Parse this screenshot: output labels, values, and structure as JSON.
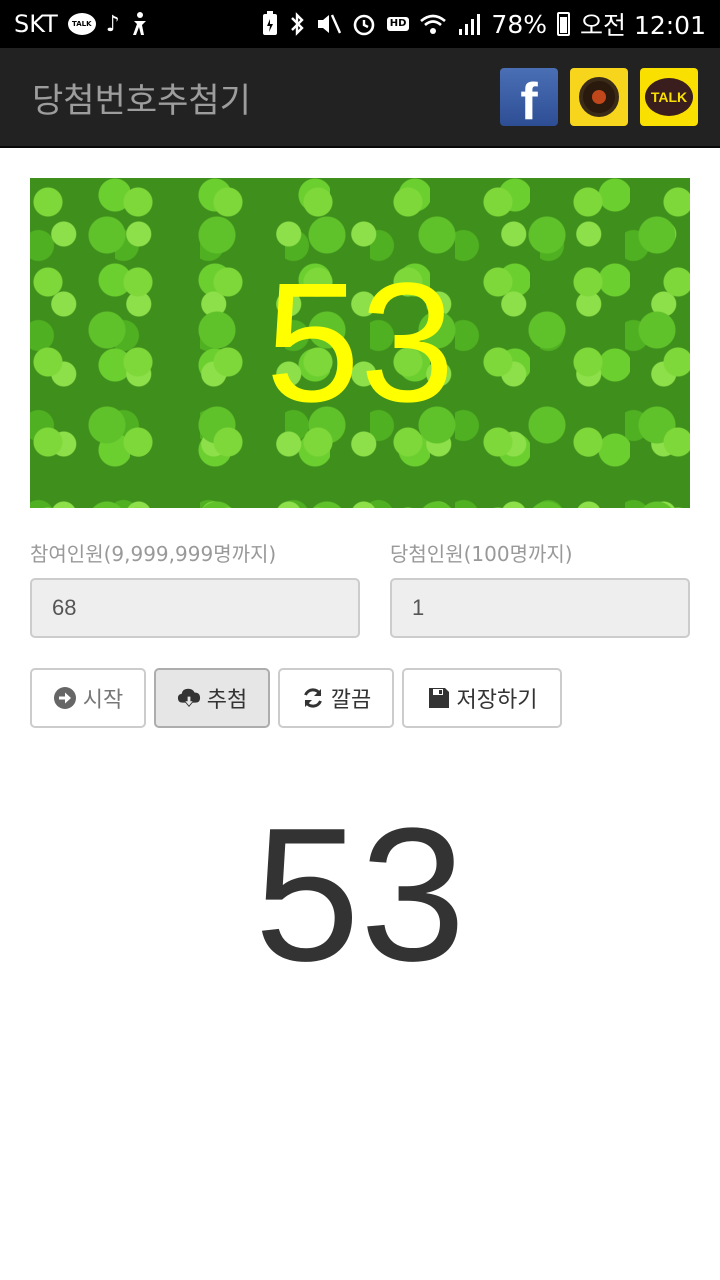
{
  "status_bar": {
    "carrier": "SKT",
    "talk_badge": "TALK",
    "hd_badge": "HD",
    "battery": "78%",
    "time": "오전 12:01"
  },
  "header": {
    "title": "당첨번호추첨기",
    "facebook_letter": "f",
    "kakaotalk_label": "TALK"
  },
  "banner": {
    "number": "53"
  },
  "form": {
    "participants_label": "참여인원(9,999,999명까지)",
    "participants_value": "68",
    "winners_label": "당첨인원(100명까지)",
    "winners_value": "1"
  },
  "buttons": {
    "start": "시작",
    "draw": "추첨",
    "clear": "깔끔",
    "save": "저장하기"
  },
  "result": {
    "number": "53"
  },
  "colors": {
    "action_bar": "#222222",
    "title": "#9d9d9d",
    "banner_number": "#ffff00",
    "input_bg": "#eeeeee"
  }
}
